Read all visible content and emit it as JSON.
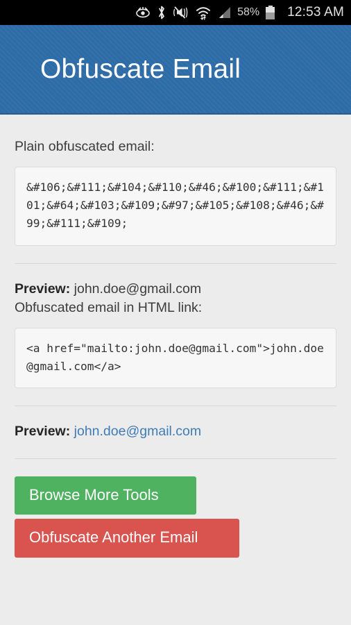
{
  "statusbar": {
    "icons": [
      {
        "name": "eye-icon"
      },
      {
        "name": "bluetooth-icon"
      },
      {
        "name": "vibrate-mute-icon"
      },
      {
        "name": "wifi-transfer-icon"
      },
      {
        "name": "cellular-signal-icon"
      }
    ],
    "battery_percent": "58%",
    "clock": "12:53 AM",
    "background_color": "#000000"
  },
  "header": {
    "title": "Obfuscate Email",
    "background_color": "#2e6ca8",
    "text_color": "#ffffff"
  },
  "main": {
    "plain_label": "Plain obfuscated email:",
    "plain_code": "&#106;&#111;&#104;&#110;&#46;&#100;&#111;&#101;&#64;&#103;&#109;&#97;&#105;&#108;&#46;&#99;&#111;&#109;",
    "preview_label": "Preview:",
    "preview_value": "john.doe@gmail.com",
    "html_link_label": "Obfuscated email in HTML link:",
    "html_code": "<a href=\"mailto:john.doe@gmail.com\">john.doe@gmail.com</a>",
    "preview_link_label": "Preview:",
    "preview_link_value": "john.doe@gmail.com",
    "link_color": "#3f7cb6"
  },
  "buttons": {
    "browse_label": "Browse More Tools",
    "browse_color": "#4fb260",
    "obfuscate_label": "Obfuscate Another Email",
    "obfuscate_color": "#d9534f"
  }
}
